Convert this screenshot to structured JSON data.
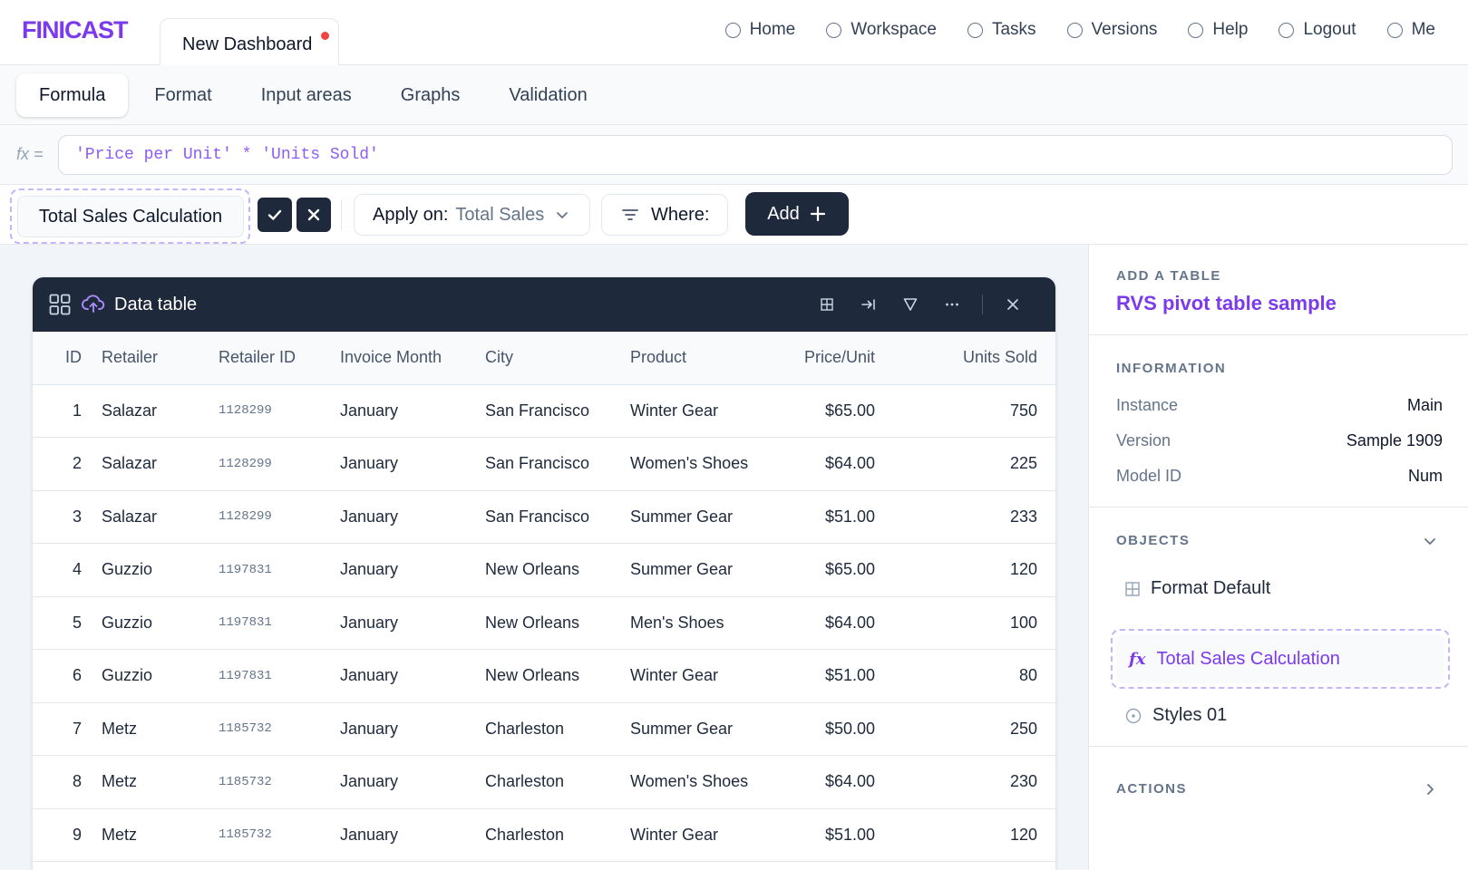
{
  "app": {
    "logo": "FINICAST"
  },
  "document_tab": {
    "label": "New Dashboard"
  },
  "nav": [
    {
      "label": "Home"
    },
    {
      "label": "Workspace"
    },
    {
      "label": "Tasks"
    },
    {
      "label": "Versions"
    },
    {
      "label": "Help"
    },
    {
      "label": "Logout"
    },
    {
      "label": "Me"
    }
  ],
  "tabs": [
    {
      "label": "Formula",
      "active": true
    },
    {
      "label": "Format"
    },
    {
      "label": "Input areas"
    },
    {
      "label": "Graphs"
    },
    {
      "label": "Validation"
    }
  ],
  "formula": {
    "prefix": "fx =",
    "expression": "'Price per Unit' * 'Units Sold'"
  },
  "toolbar": {
    "calc_name": "Total Sales Calculation",
    "apply_label": "Apply on:",
    "apply_value": "Total Sales",
    "where_label": "Where:",
    "add_label": "Add"
  },
  "table": {
    "title": "Data table",
    "columns": [
      "ID",
      "Retailer",
      "Retailer ID",
      "Invoice Month",
      "City",
      "Product",
      "Price/Unit",
      "Units Sold"
    ],
    "rows": [
      [
        "1",
        "Salazar",
        "1128299",
        "January",
        "San Francisco",
        "Winter Gear",
        "$65.00",
        "750"
      ],
      [
        "2",
        "Salazar",
        "1128299",
        "January",
        "San Francisco",
        "Women's Shoes",
        "$64.00",
        "225"
      ],
      [
        "3",
        "Salazar",
        "1128299",
        "January",
        "San Francisco",
        "Summer Gear",
        "$51.00",
        "233"
      ],
      [
        "4",
        "Guzzio",
        "1197831",
        "January",
        "New Orleans",
        "Summer Gear",
        "$65.00",
        "120"
      ],
      [
        "5",
        "Guzzio",
        "1197831",
        "January",
        "New Orleans",
        "Men's Shoes",
        "$64.00",
        "100"
      ],
      [
        "6",
        "Guzzio",
        "1197831",
        "January",
        "New Orleans",
        "Winter Gear",
        "$51.00",
        "80"
      ],
      [
        "7",
        "Metz",
        "1185732",
        "January",
        "Charleston",
        "Summer Gear",
        "$50.00",
        "250"
      ],
      [
        "8",
        "Metz",
        "1185732",
        "January",
        "Charleston",
        "Women's Shoes",
        "$64.00",
        "230"
      ],
      [
        "9",
        "Metz",
        "1185732",
        "January",
        "Charleston",
        "Winter Gear",
        "$51.00",
        "120"
      ]
    ]
  },
  "side": {
    "add_table_label": "ADD A TABLE",
    "table_name": "RVS pivot table sample",
    "information_label": "INFORMATION",
    "info": [
      {
        "key": "Instance",
        "value": "Main"
      },
      {
        "key": "Version",
        "value": "Sample 1909"
      },
      {
        "key": "Model ID",
        "value": "Num"
      }
    ],
    "objects_label": "OBJECTS",
    "objects": [
      {
        "label": "Format Default",
        "icon": "table-grid-icon"
      },
      {
        "label": "Total Sales Calculation",
        "icon": "fx-icon",
        "selected": true
      },
      {
        "label": "Styles 01",
        "icon": "target-circle-icon"
      }
    ],
    "actions_label": "ACTIONS"
  },
  "colors": {
    "brand": "#7c3aed",
    "dark": "#1e293b",
    "selection_dash": "#c4b5fd",
    "notify": "#ef4444"
  }
}
